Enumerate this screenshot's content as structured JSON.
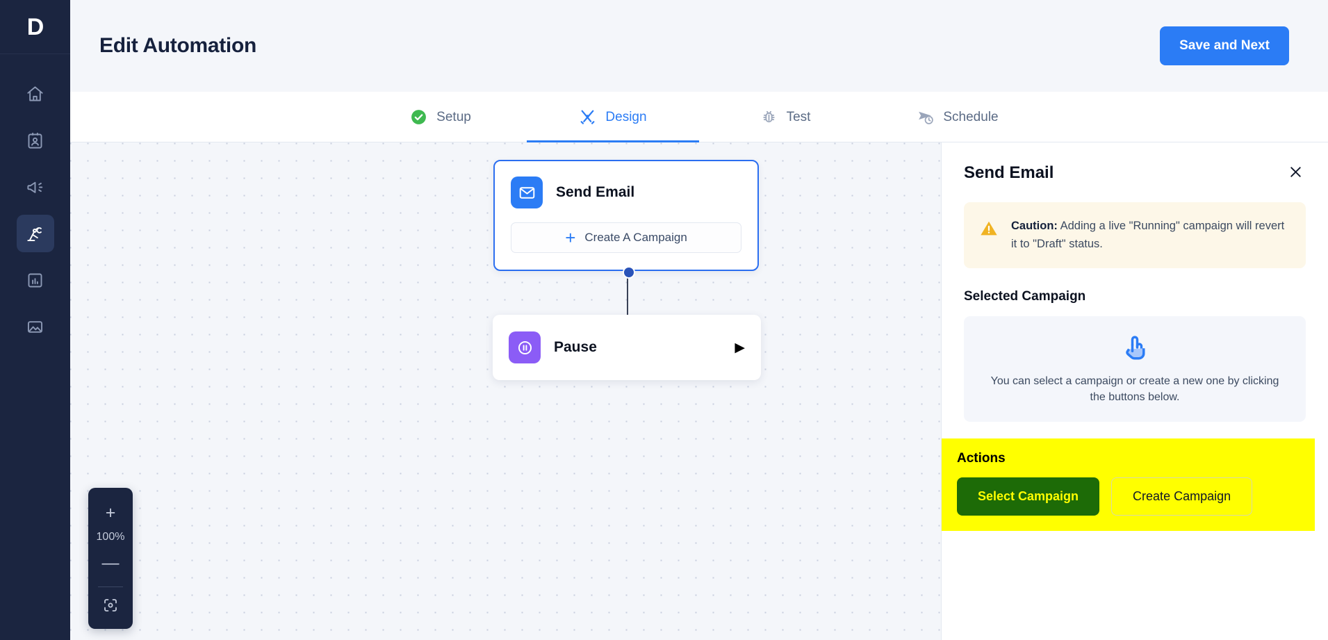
{
  "sidebar": {
    "logo": "D",
    "items": [
      {
        "icon": "home-icon",
        "name": "home"
      },
      {
        "icon": "contacts-icon",
        "name": "contacts"
      },
      {
        "icon": "megaphone-icon",
        "name": "campaigns"
      },
      {
        "icon": "robot-arm-icon",
        "name": "automations",
        "active": true
      },
      {
        "icon": "bar-chart-icon",
        "name": "reports"
      },
      {
        "icon": "image-icon",
        "name": "media"
      }
    ]
  },
  "header": {
    "title": "Edit Automation",
    "save_label": "Save and Next"
  },
  "tabs": [
    {
      "label": "Setup",
      "icon": "check-circle-icon",
      "active": false
    },
    {
      "label": "Design",
      "icon": "tools-icon",
      "active": true
    },
    {
      "label": "Test",
      "icon": "bug-icon",
      "active": false
    },
    {
      "label": "Schedule",
      "icon": "send-clock-icon",
      "active": false
    }
  ],
  "canvas": {
    "nodes": [
      {
        "id": "send-email",
        "title": "Send Email",
        "icon": "envelope-icon",
        "selected": true,
        "action_label": "Create A Campaign",
        "action_icon": "plus-icon"
      },
      {
        "id": "pause",
        "title": "Pause",
        "icon": "pause-circle-icon",
        "selected": false,
        "arrow": "▶"
      }
    ],
    "zoom": {
      "zoom_in": "+",
      "level": "100%",
      "zoom_out": "—",
      "fit_icon": "fit-to-screen-icon"
    }
  },
  "panel": {
    "title": "Send Email",
    "close_icon": "close-icon",
    "caution": {
      "icon": "warning-triangle-icon",
      "label": "Caution:",
      "message": "Adding a live \"Running\" campaign will revert it to \"Draft\" status."
    },
    "selected_campaign": {
      "heading": "Selected Campaign",
      "empty_icon": "click-hand-icon",
      "empty_text": "You can select a campaign or create a new one by clicking the buttons below."
    },
    "actions": {
      "heading": "Actions",
      "select_label": "Select Campaign",
      "create_label": "Create Campaign",
      "highlight_color": "#ffff00",
      "select_bg": "#1d6b07",
      "select_fg": "#ffff00"
    }
  },
  "colors": {
    "accent_blue": "#2b7cf5",
    "sidebar_bg": "#1b2540",
    "node_purple": "#8b5cf6",
    "caution_bg": "#fdf7e8",
    "caution_amber": "#f0b323"
  }
}
